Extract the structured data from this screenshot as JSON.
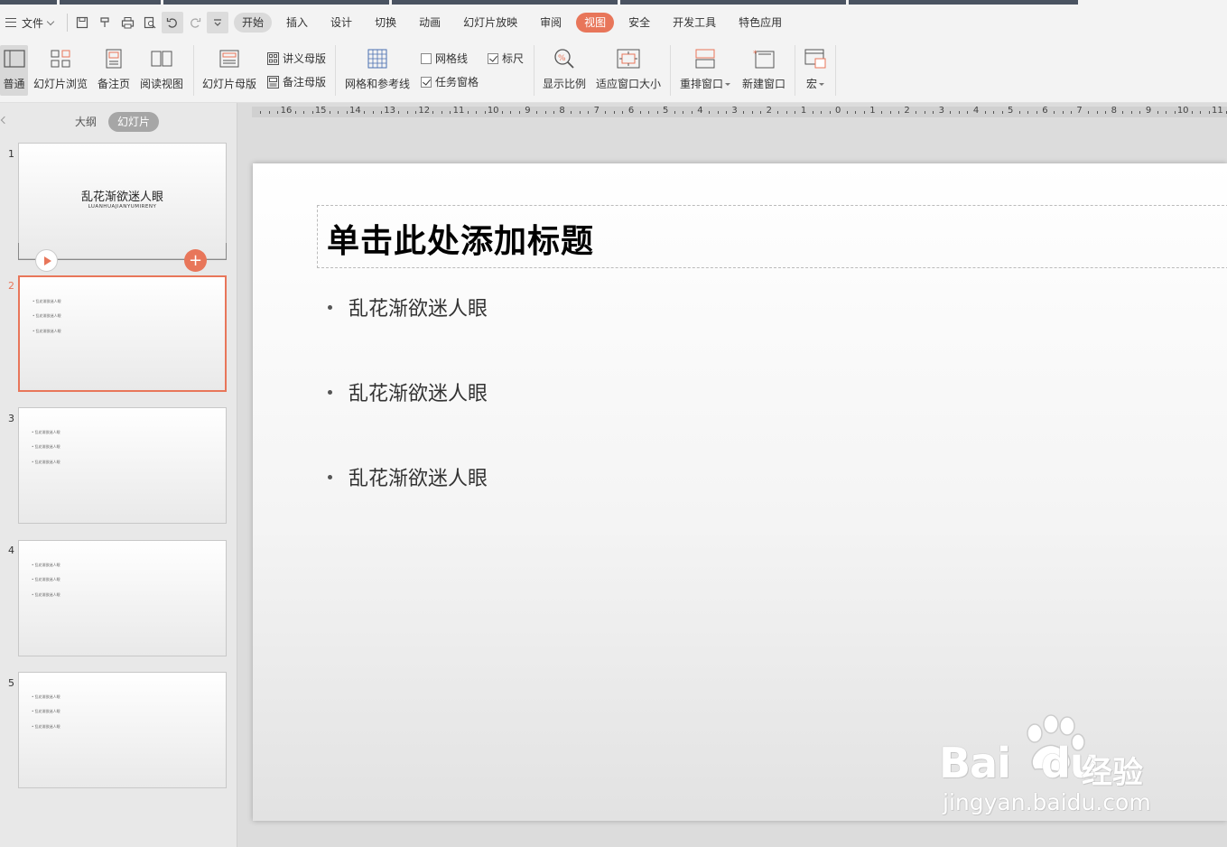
{
  "menubar": {
    "file_label": "文件",
    "tabs": [
      "开始",
      "插入",
      "设计",
      "切换",
      "动画",
      "幻灯片放映",
      "审阅",
      "视图",
      "安全",
      "开发工具",
      "特色应用"
    ],
    "active_tab": "视图",
    "accent_color": "#e8765a"
  },
  "toolbar": {
    "normal": "普通",
    "slide_sorter": "幻灯片浏览",
    "notes_page": "备注页",
    "reading_view": "阅读视图",
    "slide_master": "幻灯片母版",
    "handout_master": "讲义母版",
    "notes_master": "备注母版",
    "grid_guides": "网格和参考线",
    "gridlines": "网格线",
    "ruler": "标尺",
    "task_pane": "任务窗格",
    "zoom": "显示比例",
    "fit_window": "适应窗口大小",
    "arrange": "重排窗口",
    "new_window": "新建窗口",
    "macro": "宏"
  },
  "panel": {
    "outline_tab": "大纲",
    "slides_tab": "幻灯片"
  },
  "thumbnails": [
    {
      "num": "1",
      "title": "乱花渐欲迷人眼",
      "subtitle": "LUANHUAJIANYUMIRENY"
    },
    {
      "num": "2",
      "bullets": [
        "乱花渐欲迷人眼",
        "乱花渐欲迷人眼",
        "乱花渐欲迷人眼"
      ]
    },
    {
      "num": "3",
      "bullets": [
        "乱花渐欲迷人眼",
        "乱花渐欲迷人眼",
        "乱花渐欲迷人眼"
      ]
    },
    {
      "num": "4",
      "bullets": [
        "乱花渐欲迷人眼",
        "乱花渐欲迷人眼",
        "乱花渐欲迷人眼"
      ]
    },
    {
      "num": "5",
      "bullets": [
        "乱花渐欲迷人眼",
        "乱花渐欲迷人眼",
        "乱花渐欲迷人眼"
      ]
    }
  ],
  "ruler": {
    "labels": [
      "16",
      "15",
      "14",
      "13",
      "12",
      "11",
      "10",
      "9",
      "8",
      "7",
      "6",
      "5",
      "4",
      "3",
      "2",
      "1",
      "0",
      "1",
      "2",
      "3",
      "4",
      "5",
      "6",
      "7",
      "8",
      "9",
      "10",
      "11"
    ]
  },
  "slide": {
    "title_placeholder": "单击此处添加标题",
    "bullets": [
      "乱花渐欲迷人眼",
      "乱花渐欲迷人眼",
      "乱花渐欲迷人眼"
    ]
  },
  "watermark": {
    "brand": "Bai",
    "brand2": "du",
    "product": "经验",
    "url": "jingyan.baidu.com"
  }
}
